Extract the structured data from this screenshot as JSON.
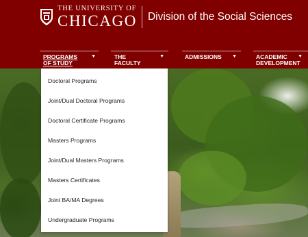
{
  "header": {
    "university_top": "THE UNIVERSITY OF",
    "university_bottom": "CHICAGO",
    "division": "Division of the Social Sciences",
    "colors": {
      "maroon": "#800000",
      "text": "#ffffff"
    }
  },
  "nav": {
    "items": [
      {
        "label_line1": "PROGRAMS",
        "label_line2": "OF STUDY",
        "icon": "chevron-down-icon",
        "active": true
      },
      {
        "label_line1": "THE",
        "label_line2": "FACULTY",
        "icon": "chevron-down-icon",
        "active": false
      },
      {
        "label_line1": "ADMISSIONS",
        "label_line2": "",
        "icon": "chevron-down-icon",
        "active": false
      },
      {
        "label_line1": "ACADEMIC",
        "label_line2": "DEVELOPMENT",
        "icon": "chevron-down-icon",
        "active": false
      }
    ],
    "caret": "▼"
  },
  "dropdown": {
    "items": [
      "Doctoral Programs",
      "Joint/Dual Doctoral Programs",
      "Doctoral Certificate Programs",
      "Masters Programs",
      "Joint/Dual Masters Programs",
      "Masters Certificates",
      "Joint BA/MA Degrees",
      "Undergraduate Programs"
    ]
  }
}
